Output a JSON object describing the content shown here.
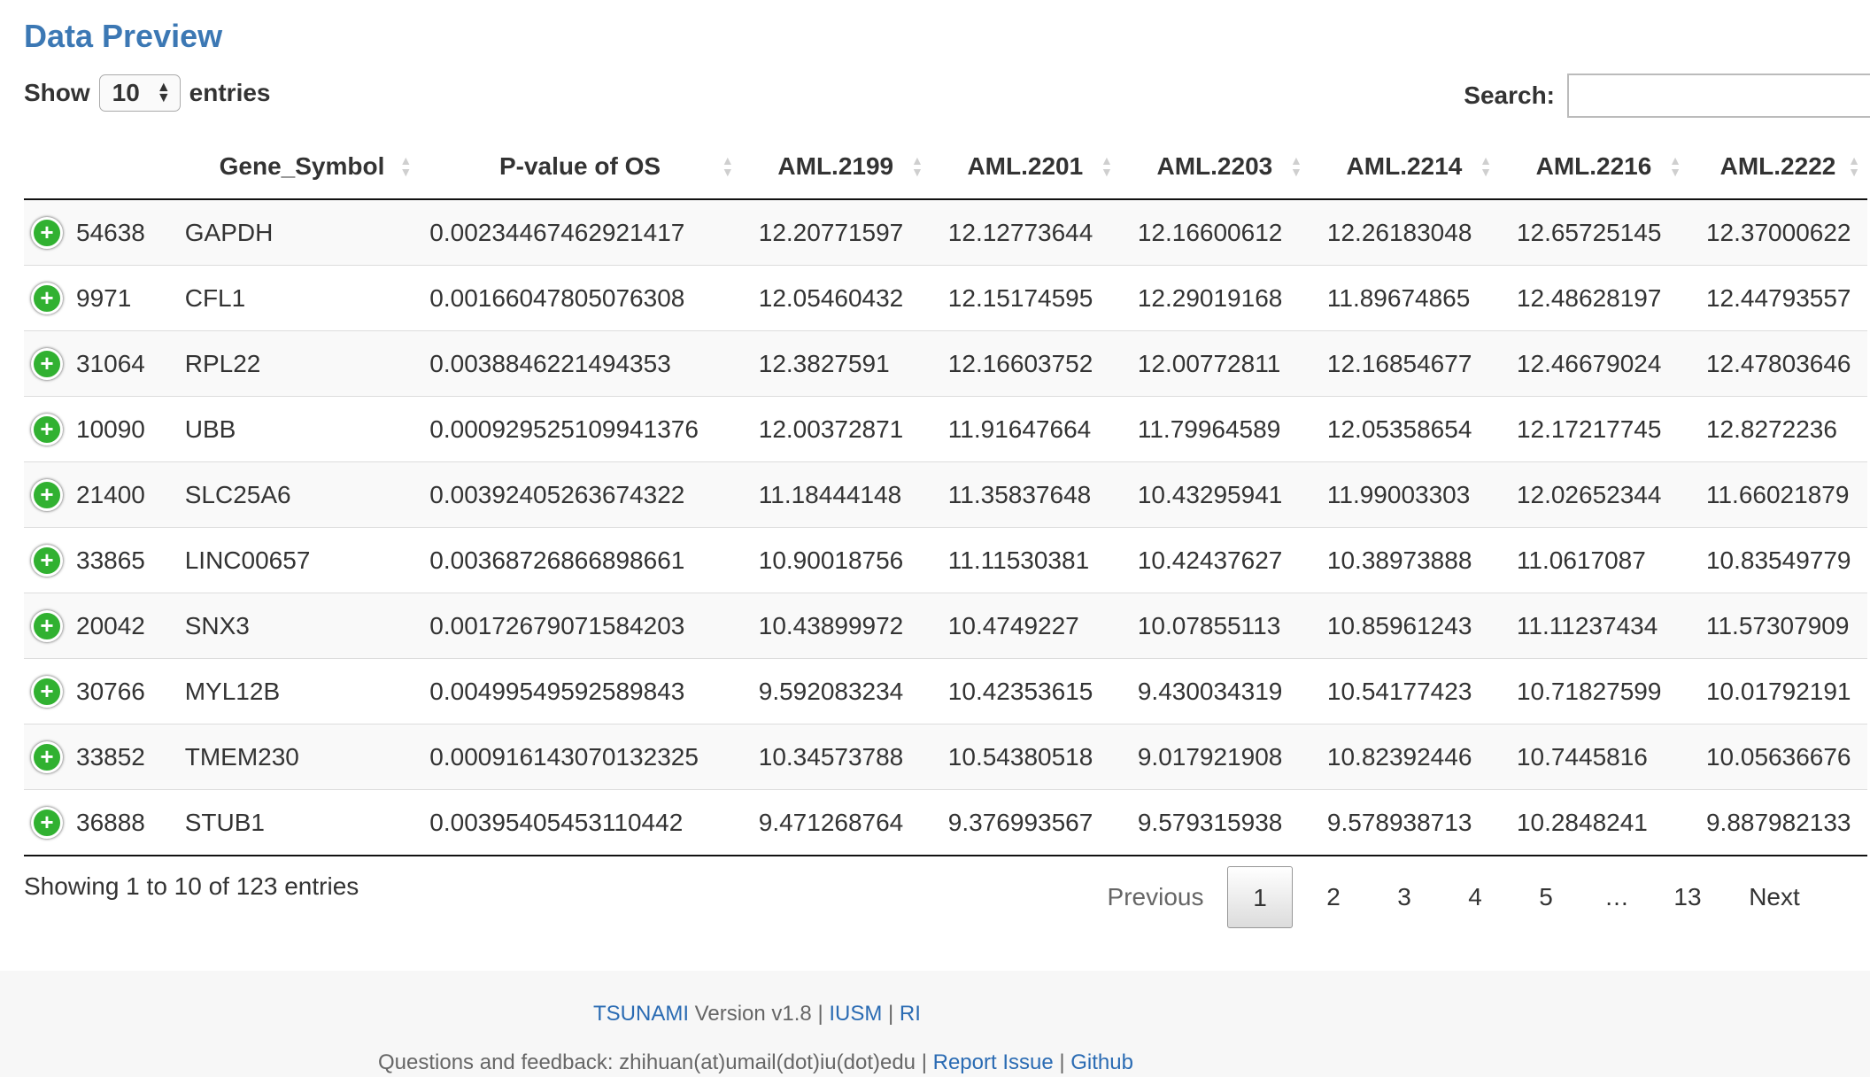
{
  "title": "Data Preview",
  "length_menu": {
    "prefix": "Show",
    "value": "10",
    "suffix": "entries"
  },
  "search": {
    "label": "Search:",
    "value": ""
  },
  "columns": [
    "",
    "Gene_Symbol",
    "P-value of OS",
    "AML.2199",
    "AML.2201",
    "AML.2203",
    "AML.2214",
    "AML.2216",
    "AML.2222"
  ],
  "rows": [
    [
      "54638",
      "GAPDH",
      "0.00234467462921417",
      "12.20771597",
      "12.12773644",
      "12.16600612",
      "12.26183048",
      "12.65725145",
      "12.37000622"
    ],
    [
      "9971",
      "CFL1",
      "0.00166047805076308",
      "12.05460432",
      "12.15174595",
      "12.29019168",
      "11.89674865",
      "12.48628197",
      "12.44793557"
    ],
    [
      "31064",
      "RPL22",
      "0.0038846221494353",
      "12.3827591",
      "12.16603752",
      "12.00772811",
      "12.16854677",
      "12.46679024",
      "12.47803646"
    ],
    [
      "10090",
      "UBB",
      "0.000929525109941376",
      "12.00372871",
      "11.91647664",
      "11.79964589",
      "12.05358654",
      "12.17217745",
      "12.8272236"
    ],
    [
      "21400",
      "SLC25A6",
      "0.00392405263674322",
      "11.18444148",
      "11.35837648",
      "10.43295941",
      "11.99003303",
      "12.02652344",
      "11.66021879"
    ],
    [
      "33865",
      "LINC00657",
      "0.00368726866898661",
      "10.90018756",
      "11.11530381",
      "10.42437627",
      "10.38973888",
      "11.0617087",
      "10.83549779"
    ],
    [
      "20042",
      "SNX3",
      "0.00172679071584203",
      "10.43899972",
      "10.4749227",
      "10.07855113",
      "10.85961243",
      "11.11237434",
      "11.57307909"
    ],
    [
      "30766",
      "MYL12B",
      "0.00499549592589843",
      "9.592083234",
      "10.42353615",
      "9.430034319",
      "10.54177423",
      "10.71827599",
      "10.01792191"
    ],
    [
      "33852",
      "TMEM230",
      "0.000916143070132325",
      "10.34573788",
      "10.54380518",
      "9.017921908",
      "10.82392446",
      "10.7445816",
      "10.05636676"
    ],
    [
      "36888",
      "STUB1",
      "0.00395405453110442",
      "9.471268764",
      "9.376993567",
      "9.579315938",
      "9.578938713",
      "10.2848241",
      "9.887982133"
    ]
  ],
  "info": "Showing 1 to 10 of 123 entries",
  "pagination": {
    "previous": "Previous",
    "current": "1",
    "pages": [
      "2",
      "3",
      "4",
      "5"
    ],
    "ellipsis": "…",
    "last": "13",
    "next": "Next"
  },
  "footer": {
    "app": "TSUNAMI",
    "version": "Version v1.8",
    "sep": "|",
    "iusm": "IUSM",
    "ri": "RI",
    "feedback": "Questions and feedback: zhihuan(at)umail(dot)iu(dot)edu",
    "report": "Report Issue",
    "github": "Github"
  },
  "colors": {
    "title": "#3c78b4",
    "link": "#2a6bb3",
    "expand_button": "#31b131"
  }
}
